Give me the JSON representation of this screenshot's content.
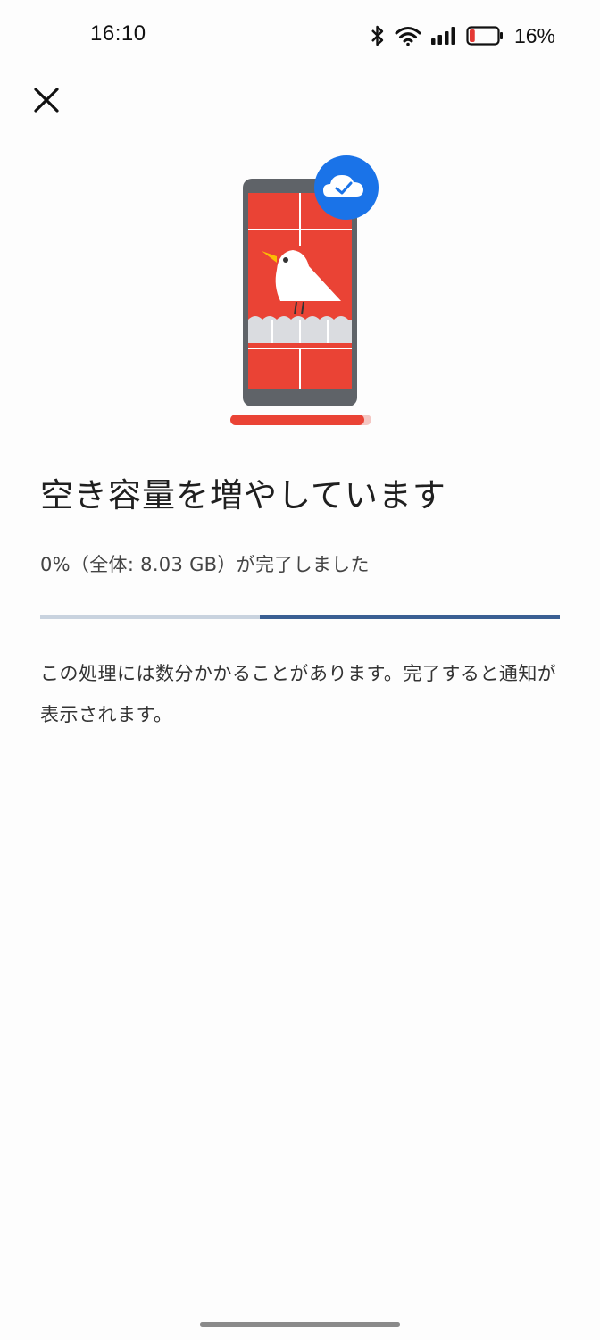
{
  "status_bar": {
    "time": "16:10",
    "battery_percent": "16%",
    "battery_level": 0.16,
    "icons": [
      "bluetooth-icon",
      "wifi-icon",
      "signal-icon",
      "battery-icon"
    ]
  },
  "header": {
    "close_icon": "close-icon"
  },
  "main": {
    "title": "空き容量を増やしています",
    "progress_text": "0%（全体: 8.03 GB）が完了しました",
    "progress_value": 0,
    "description": "この処理には数分かかることがあります。完了すると通知が表示されます。"
  },
  "colors": {
    "accent_blue": "#1a73e8",
    "illustration_red": "#ea4335",
    "progress_track": "#c9d3df",
    "progress_indicator": "#3a5f93"
  }
}
